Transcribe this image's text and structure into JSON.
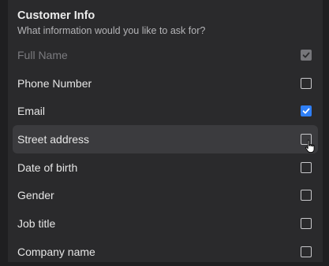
{
  "header": {
    "title": "Customer Info",
    "subtitle": "What information would you like to ask for?"
  },
  "fields": [
    {
      "label": "Full Name",
      "checked": true,
      "disabled": true,
      "hovered": false
    },
    {
      "label": "Phone Number",
      "checked": false,
      "disabled": false,
      "hovered": false
    },
    {
      "label": "Email",
      "checked": true,
      "disabled": false,
      "hovered": false
    },
    {
      "label": "Street address",
      "checked": false,
      "disabled": false,
      "hovered": true
    },
    {
      "label": "Date of birth",
      "checked": false,
      "disabled": false,
      "hovered": false
    },
    {
      "label": "Gender",
      "checked": false,
      "disabled": false,
      "hovered": false
    },
    {
      "label": "Job title",
      "checked": false,
      "disabled": false,
      "hovered": false
    },
    {
      "label": "Company name",
      "checked": false,
      "disabled": false,
      "hovered": false
    }
  ],
  "colors": {
    "accent": "#2f7ff7",
    "panel": "#2a2a2c",
    "hover": "#3b3b3e"
  },
  "icons": {
    "check": "check-icon",
    "cursor": "pointer-cursor-icon"
  }
}
